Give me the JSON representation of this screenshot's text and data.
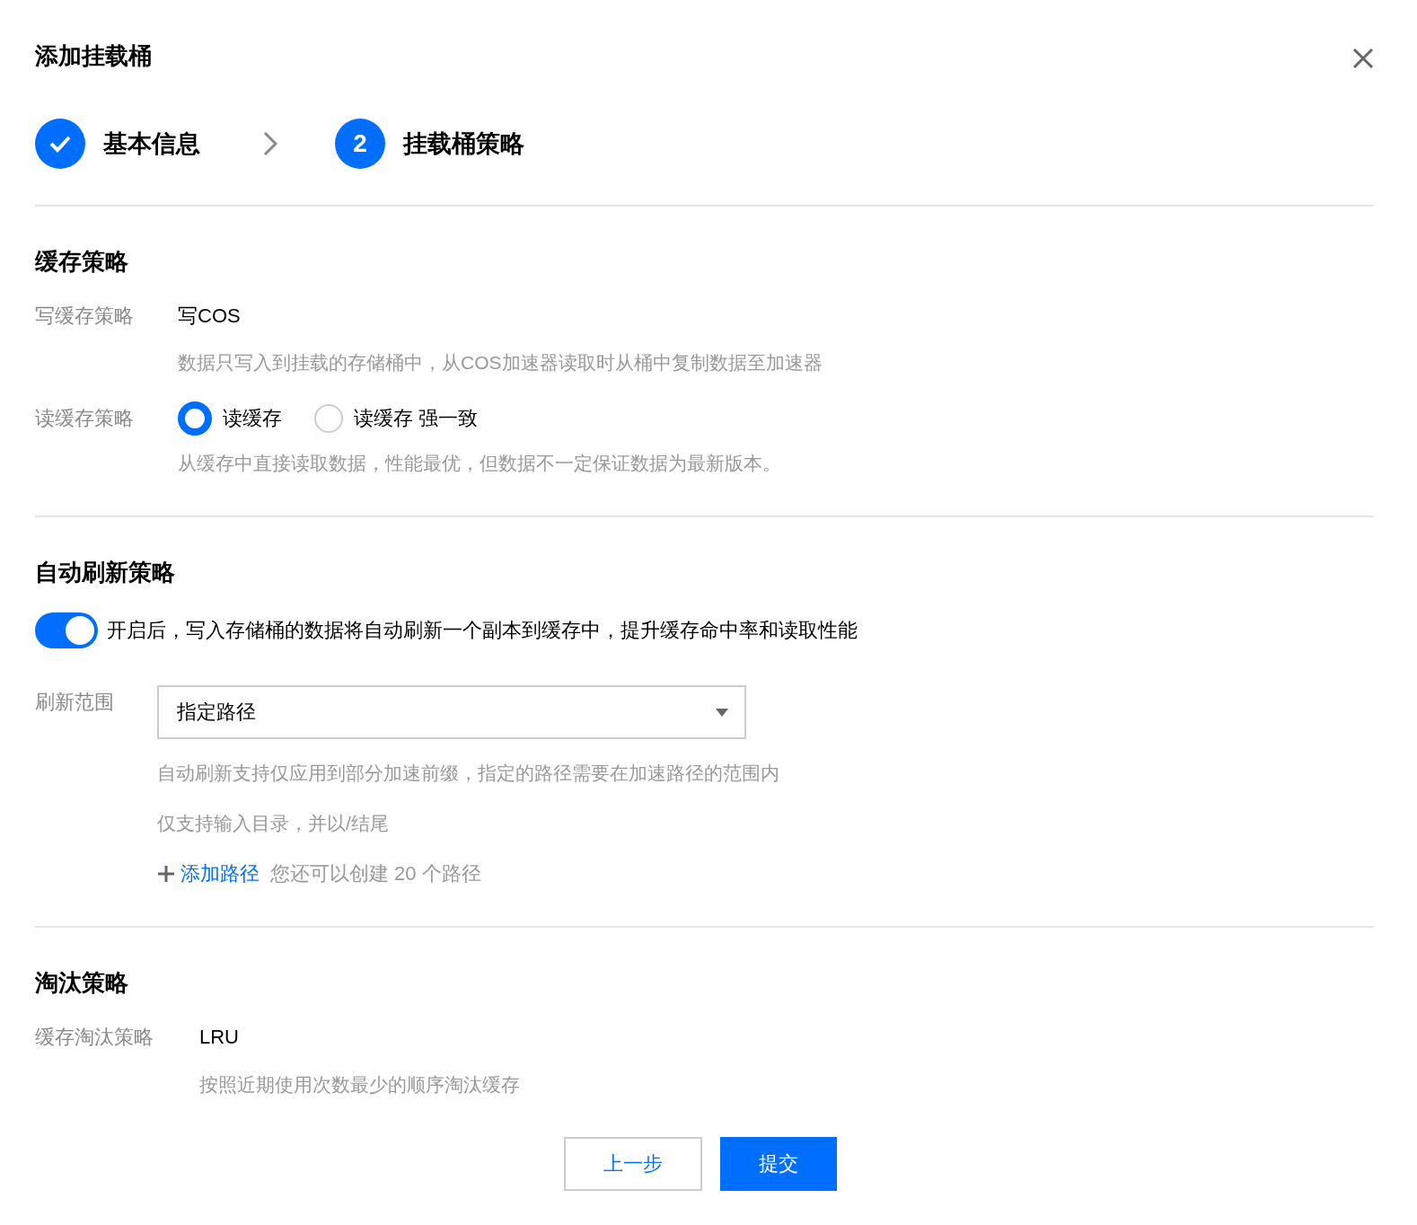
{
  "dialog": {
    "title": "添加挂载桶"
  },
  "steps": [
    {
      "label": "基本信息",
      "completed": true
    },
    {
      "number": "2",
      "label": "挂载桶策略",
      "completed": false
    }
  ],
  "cache_policy": {
    "heading": "缓存策略",
    "write": {
      "label": "写缓存策略",
      "value": "写COS",
      "help": "数据只写入到挂载的存储桶中，从COS加速器读取时从桶中复制数据至加速器"
    },
    "read": {
      "label": "读缓存策略",
      "options": [
        {
          "label": "读缓存",
          "selected": true
        },
        {
          "label": "读缓存 强一致",
          "selected": false
        }
      ],
      "help": "从缓存中直接读取数据，性能最优，但数据不一定保证数据为最新版本。"
    }
  },
  "auto_refresh": {
    "heading": "自动刷新策略",
    "toggle": {
      "on": true,
      "description": "开启后，写入存储桶的数据将自动刷新一个副本到缓存中，提升缓存命中率和读取性能"
    },
    "scope": {
      "label": "刷新范围",
      "value": "指定路径",
      "hints": [
        "自动刷新支持仅应用到部分加速前缀，指定的路径需要在加速路径的范围内",
        "仅支持输入目录，并以/结尾"
      ],
      "add_link": "添加路径",
      "quota": "您还可以创建 20 个路径"
    }
  },
  "eviction": {
    "heading": "淘汰策略",
    "label": "缓存淘汰策略",
    "value": "LRU",
    "help": "按照近期使用次数最少的顺序淘汰缓存"
  },
  "buttons": [
    {
      "label": "上一步",
      "kind": "secondary"
    },
    {
      "label": "提交",
      "kind": "primary"
    }
  ]
}
